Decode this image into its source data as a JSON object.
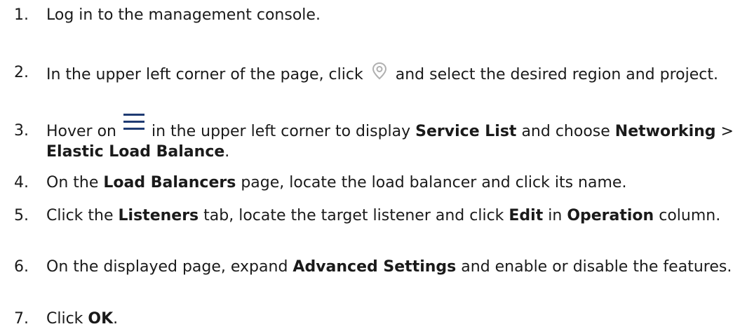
{
  "steps": [
    {
      "num": "1.",
      "text": "Log in to the management console."
    },
    {
      "num": "2.",
      "pre": "In the upper left corner of the page, click",
      "post": "and select the desired region and project.",
      "icon": "location-pin-icon"
    },
    {
      "num": "3.",
      "pre": "Hover on",
      "mid1": "in the upper left corner to display",
      "b1": "Service List",
      "mid2": "and choose",
      "b2": "Networking",
      "sep": ">",
      "b3": "Elastic Load Balance",
      "end": ".",
      "icon": "hamburger-menu-icon"
    },
    {
      "num": "4.",
      "pre": "On the",
      "b1": "Load Balancers",
      "post": "page, locate the load balancer and click its name."
    },
    {
      "num": "5.",
      "pre": "Click the",
      "b1": "Listeners",
      "mid1": "tab, locate the target listener and click",
      "b2": "Edit",
      "mid2": "in",
      "b3": "Operation",
      "post": "column."
    },
    {
      "num": "6.",
      "pre": "On the displayed page, expand",
      "b1": "Advanced Settings",
      "post": "and enable or disable the features."
    },
    {
      "num": "7.",
      "pre": "Click",
      "b1": "OK",
      "end": "."
    }
  ],
  "colors": {
    "text": "#1a1a1a",
    "pin_icon": "#b0b0b0",
    "menu_icon": "#1f3b73"
  }
}
